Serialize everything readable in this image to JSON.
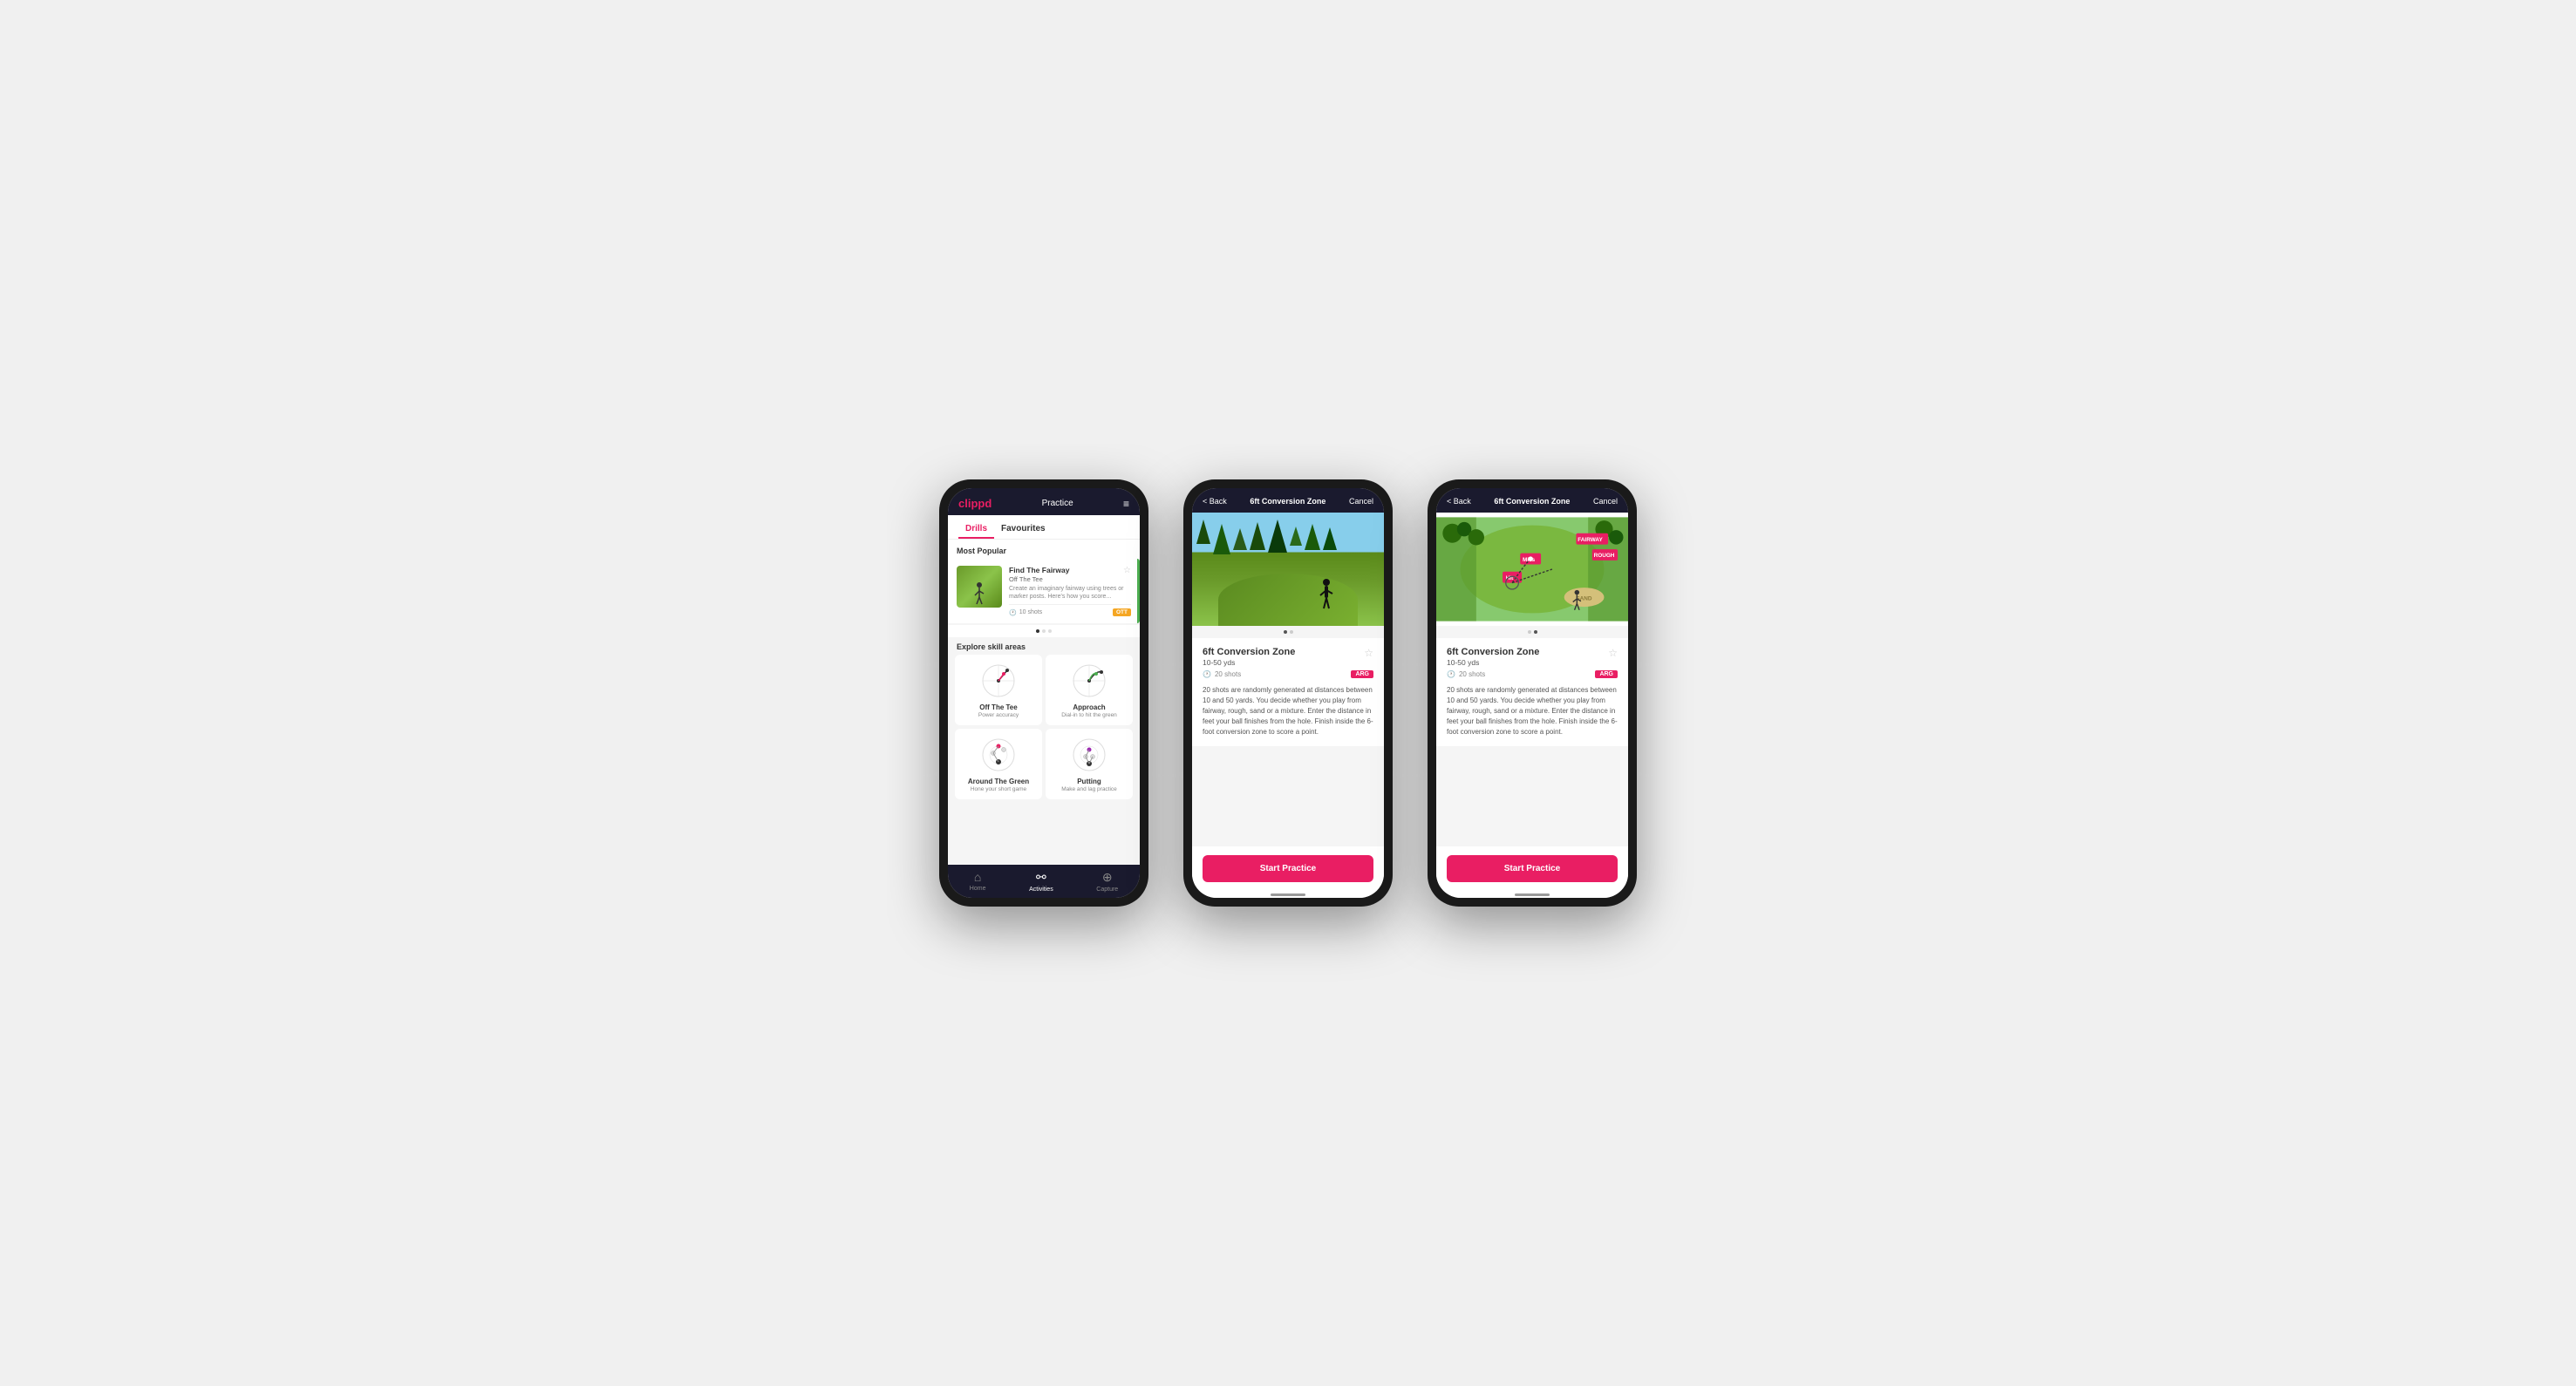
{
  "phone1": {
    "header": {
      "logo": "clippd",
      "title": "Practice",
      "menu_icon": "≡"
    },
    "tabs": [
      {
        "label": "Drills",
        "active": true
      },
      {
        "label": "Favourites",
        "active": false
      }
    ],
    "most_popular": {
      "section_title": "Most Popular",
      "card": {
        "title": "Find The Fairway",
        "subtitle": "Off The Tee",
        "description": "Create an imaginary fairway using trees or marker posts. Here's how you score...",
        "shots": "10 shots",
        "tag": "OTT",
        "dots": [
          true,
          false,
          false
        ]
      }
    },
    "explore": {
      "section_title": "Explore skill areas",
      "skills": [
        {
          "name": "Off The Tee",
          "desc": "Power accuracy"
        },
        {
          "name": "Approach",
          "desc": "Dial-in to hit the green"
        },
        {
          "name": "Around The Green",
          "desc": "Hone your short game"
        },
        {
          "name": "Putting",
          "desc": "Make and lag practice"
        }
      ]
    },
    "bottom_nav": [
      {
        "label": "Home",
        "icon": "⌂",
        "active": false
      },
      {
        "label": "Activities",
        "icon": "⚯",
        "active": true
      },
      {
        "label": "Capture",
        "icon": "⊕",
        "active": false
      }
    ]
  },
  "phone2": {
    "header": {
      "back": "< Back",
      "title": "6ft Conversion Zone",
      "cancel": "Cancel"
    },
    "drill": {
      "title": "6ft Conversion Zone",
      "yds": "10-50 yds",
      "shots": "20 shots",
      "tag": "ARG",
      "description": "20 shots are randomly generated at distances between 10 and 50 yards. You decide whether you play from fairway, rough, sand or a mixture. Enter the distance in feet your ball finishes from the hole. Finish inside the 6-foot conversion zone to score a point.",
      "dots": [
        true,
        false
      ]
    },
    "start_button": "Start Practice"
  },
  "phone3": {
    "header": {
      "back": "< Back",
      "title": "6ft Conversion Zone",
      "cancel": "Cancel"
    },
    "drill": {
      "title": "6ft Conversion Zone",
      "yds": "10-50 yds",
      "shots": "20 shots",
      "tag": "ARG",
      "description": "20 shots are randomly generated at distances between 10 and 50 yards. You decide whether you play from fairway, rough, sand or a mixture. Enter the distance in feet your ball finishes from the hole. Finish inside the 6-foot conversion zone to score a point.",
      "dots": [
        false,
        true
      ]
    },
    "start_button": "Start Practice"
  }
}
